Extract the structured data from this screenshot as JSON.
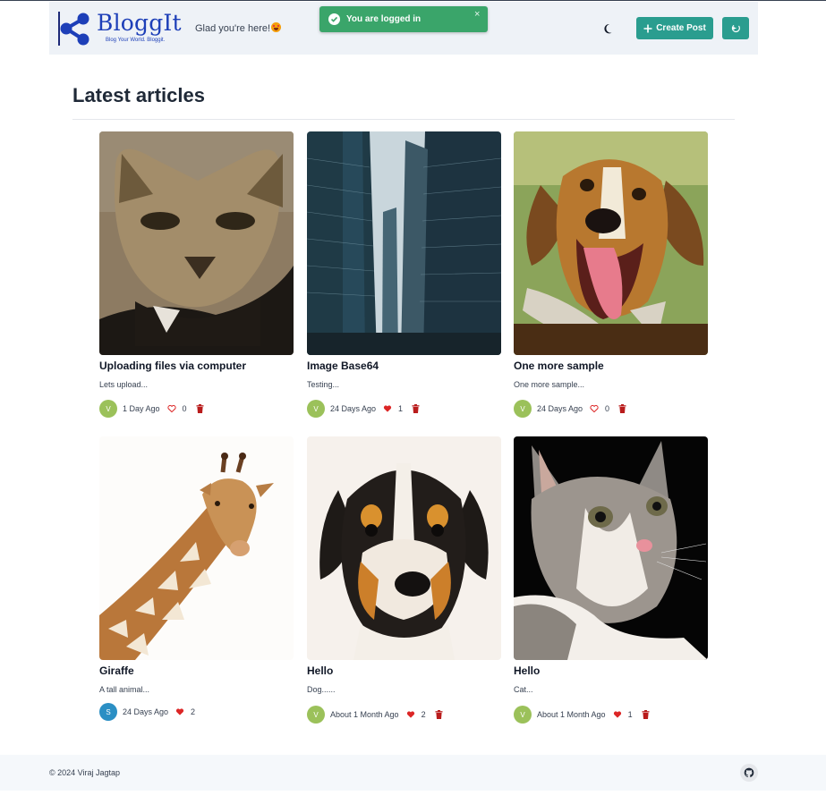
{
  "header": {
    "brand": "BloggIt",
    "tagline": "Blog Your World. Bloggit.",
    "greeting": "Glad you're here!",
    "create_label": "Create Post"
  },
  "toast": {
    "message": "You are logged in",
    "close": "×"
  },
  "main": {
    "title": "Latest articles"
  },
  "articles": [
    {
      "title": "Uploading files via computer",
      "excerpt": "Lets upload...",
      "avatar": "V",
      "avatar_color": "#9bc15a",
      "date": "1 Day Ago",
      "likes": "0",
      "liked": false,
      "deletable": true,
      "image": "cat-sphinx-photo"
    },
    {
      "title": "Image Base64",
      "excerpt": "Testing...",
      "avatar": "V",
      "avatar_color": "#9bc15a",
      "date": "24 Days Ago",
      "likes": "1",
      "liked": true,
      "deletable": true,
      "image": "city-skyscrapers-photo"
    },
    {
      "title": "One more sample",
      "excerpt": "One more sample...",
      "avatar": "V",
      "avatar_color": "#9bc15a",
      "date": "24 Days Ago",
      "likes": "0",
      "liked": false,
      "deletable": true,
      "image": "dog-bowtie-photo"
    },
    {
      "title": "Giraffe",
      "excerpt": "A tall animal...",
      "avatar": "S",
      "avatar_color": "#2b8fc4",
      "date": "24 Days Ago",
      "likes": "2",
      "liked": true,
      "deletable": false,
      "image": "giraffe-photo"
    },
    {
      "title": "Hello",
      "excerpt": "Dog......",
      "avatar": "V",
      "avatar_color": "#9bc15a",
      "date": "About 1 Month Ago",
      "likes": "2",
      "liked": true,
      "deletable": true,
      "image": "puppy-photo"
    },
    {
      "title": "Hello",
      "excerpt": "Cat...",
      "avatar": "V",
      "avatar_color": "#9bc15a",
      "date": "About 1 Month Ago",
      "likes": "1",
      "liked": true,
      "deletable": true,
      "image": "kitten-photo"
    }
  ],
  "footer": {
    "copyright": "© 2024 Viraj Jagtap"
  },
  "colors": {
    "accent": "#2a9d8f",
    "brand": "#1d3fb8",
    "toast": "#3aa56a",
    "like": "#dc2626",
    "delete": "#b91c1c"
  }
}
